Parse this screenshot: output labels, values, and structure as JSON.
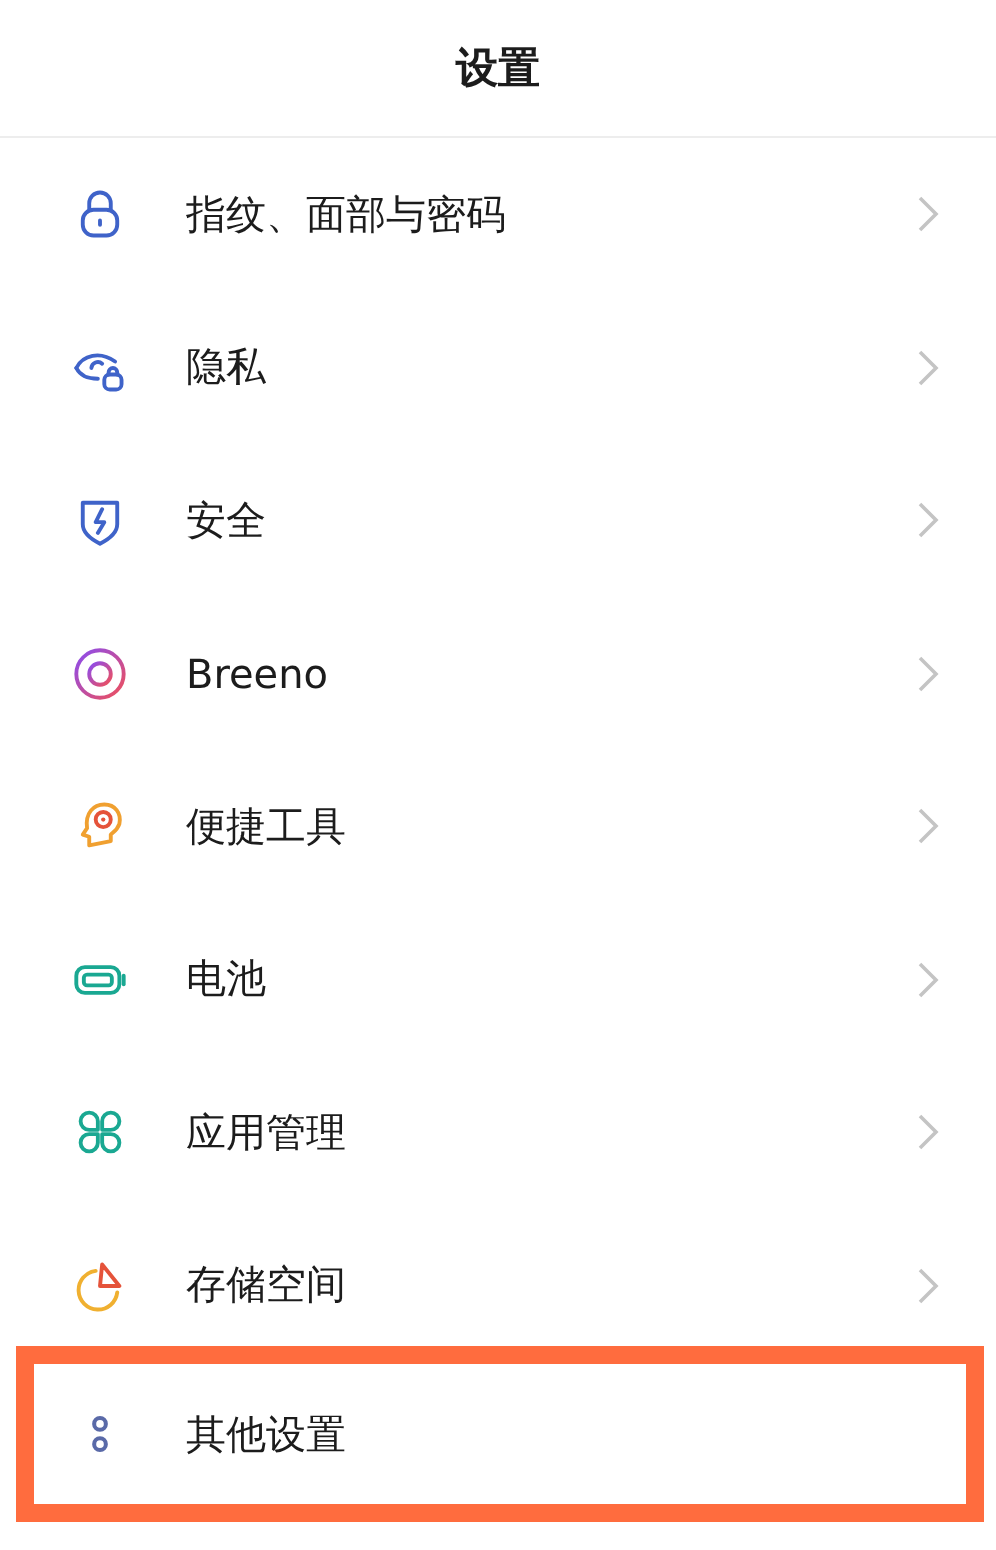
{
  "header": {
    "title": "设置"
  },
  "items": [
    {
      "label": "指纹、面部与密码",
      "chevron": true,
      "highlighted": false
    },
    {
      "label": "隐私",
      "chevron": true,
      "highlighted": false
    },
    {
      "label": "安全",
      "chevron": true,
      "highlighted": false
    },
    {
      "label": "Breeno",
      "chevron": true,
      "highlighted": false
    },
    {
      "label": "便捷工具",
      "chevron": true,
      "highlighted": false
    },
    {
      "label": "电池",
      "chevron": true,
      "highlighted": false
    },
    {
      "label": "应用管理",
      "chevron": true,
      "highlighted": false
    },
    {
      "label": "存储空间",
      "chevron": true,
      "highlighted": false
    },
    {
      "label": "其他设置",
      "chevron": false,
      "highlighted": true
    }
  ]
}
